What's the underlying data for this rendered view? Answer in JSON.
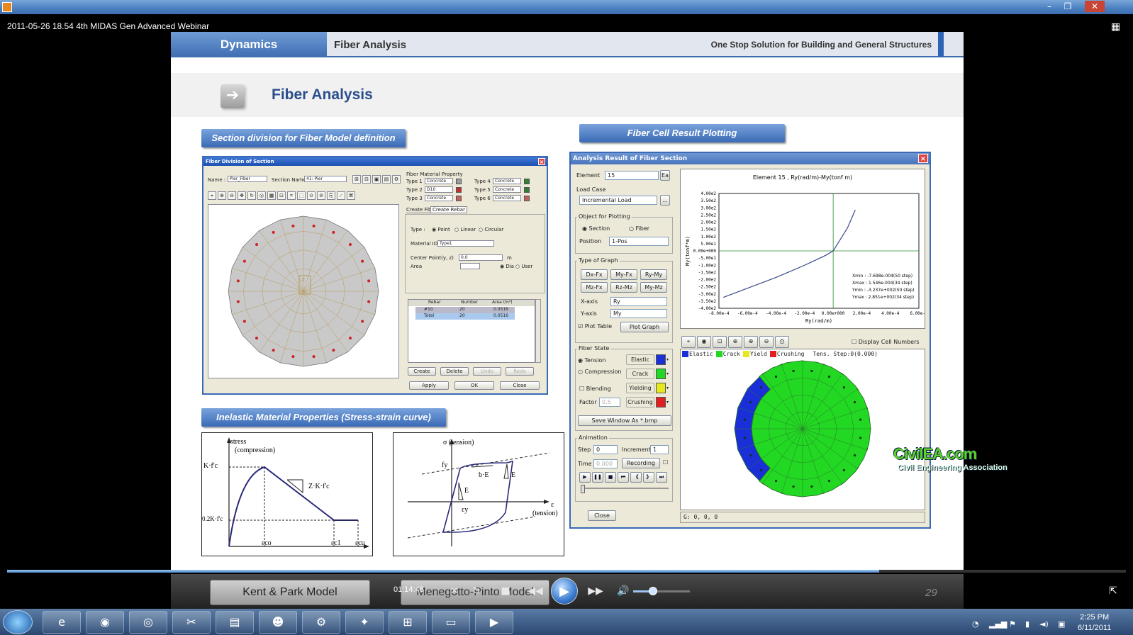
{
  "window": {
    "minimize": "–",
    "restore": "❐",
    "close": "✕"
  },
  "video_title": "2011-05-26 18.54 4th MIDAS Gen Advanced Webinar",
  "slide": {
    "tab_main": "Dynamics",
    "tab_sub": "Fiber Analysis",
    "slogan": "One Stop Solution for Building and General Structures",
    "title": "Fiber Analysis",
    "section_left": "Section division for Fiber Model definition",
    "section_right": "Fiber Cell Result Plotting",
    "section_material": "Inelastic Material Properties (Stress-strain curve)",
    "page_number": "29"
  },
  "fiber_division_dialog": {
    "title": "Fiber Division of Section",
    "name_label": "Name :",
    "name_value": "Pier_Fiber",
    "section_label": "Section Name :",
    "section_value": "41: Pier",
    "material_header": "Fiber Material Property",
    "types": [
      {
        "label": "Type 1",
        "value": "Concrete",
        "color": "#9a9a9a"
      },
      {
        "label": "Type 2",
        "value": "D10",
        "color": "#c03030"
      },
      {
        "label": "Type 3",
        "value": "Concrete",
        "color": "#c06060"
      },
      {
        "label": "Type 4",
        "value": "Concrete",
        "color": "#308030"
      },
      {
        "label": "Type 5",
        "value": "Concrete",
        "color": "#308030"
      },
      {
        "label": "Type 6",
        "value": "Concrete",
        "color": "#c06060"
      }
    ],
    "tabs": [
      "Create Fiber",
      "Create Rebar"
    ],
    "type_label": "Type :",
    "type_options": [
      "Point",
      "Linear",
      "Circular"
    ],
    "material_id_label": "Material ID :",
    "material_id_value": "Type1",
    "center_label": "Center Point(y, z)",
    "center_value": "0,0",
    "center_unit": "m",
    "area_label": "Area",
    "area_opts": [
      "Dia",
      "User"
    ],
    "table_headers": [
      "Rebar",
      "Number",
      "Area (m²)"
    ],
    "table_rows": [
      [
        "#10",
        "20",
        "0.0516"
      ],
      [
        "Total",
        "20",
        "0.0516"
      ]
    ],
    "table_buttons": [
      "Create",
      "Delete",
      "Undo",
      "Redo"
    ],
    "buttons": [
      "Apply",
      "OK",
      "Close"
    ]
  },
  "analysis_dialog": {
    "title": "Analysis Result of Fiber Section",
    "element_label": "Element",
    "element_value": "15",
    "element_btn": "Ea",
    "load_case_label": "Load Case",
    "load_case_value": "Incremental Load",
    "object_label": "Object for Plotting",
    "object_options": [
      "Section",
      "Fiber"
    ],
    "position_label": "Position",
    "position_value": "1-Pos",
    "graph_type_label": "Type of Graph",
    "graph_buttons": [
      "Dx-Fx",
      "My-Fx",
      "Ry-My",
      "Mz-Fx",
      "Rz-Mz",
      "My-Mz"
    ],
    "xaxis_label": "X-axis",
    "xaxis_value": "Ry",
    "yaxis_label": "Y-axis",
    "yaxis_value": "My",
    "plot_table_label": "Plot Table",
    "plot_graph_btn": "Plot Graph",
    "fiber_state_label": "Fiber State",
    "state_options": [
      "Tension",
      "Compression"
    ],
    "blending_label": "Blending",
    "factor_label": "Factor",
    "factor_value": "0.5",
    "states": [
      {
        "label": "Elastic",
        "color": "#1a2fd8"
      },
      {
        "label": "Crack",
        "color": "#22d822"
      },
      {
        "label": "Yielding",
        "color": "#e8e820"
      },
      {
        "label": "Crushing",
        "color": "#e02020"
      }
    ],
    "save_btn": "Save Window As *.bmp",
    "animation_label": "Animation",
    "step_label": "Step",
    "step_value": "0",
    "increment_label": "Increment",
    "increment_value": "1",
    "time_label": "Time",
    "time_value": "0.000",
    "recording_btn": "Recording",
    "anim_buttons": [
      "▶",
      "❚❚",
      "■",
      "⏮",
      "《",
      "》",
      "⏭"
    ],
    "close_btn": "Close",
    "display_cell_label": "Display Cell Numbers",
    "legend": [
      {
        "label": "Elastic",
        "color": "#1a2fd8"
      },
      {
        "label": "Crack",
        "color": "#22d822"
      },
      {
        "label": "Yield",
        "color": "#e8e820"
      },
      {
        "label": "Crushing",
        "color": "#e02020"
      }
    ],
    "legend_extra": "Tens.   Step:0(0.000)",
    "status": "G: 0, 0, 0"
  },
  "chart_data": {
    "type": "line",
    "title": "Element 15 , Ry(rad/m)-My(tonf m)",
    "xlabel": "Ry(rad/m)",
    "ylabel": "My(tonf*m)",
    "xlim": [
      -0.0008,
      0.0006
    ],
    "ylim": [
      -400.0,
      400.0
    ],
    "x_ticks": [
      "-8.00e-4",
      "-6.00e-4",
      "-4.00e-4",
      "-2.00e-4",
      "0.00e+000",
      "2.00e-4",
      "4.00e-4",
      "6.00e-4"
    ],
    "y_ticks": [
      "4.00e2",
      "3.50e2",
      "3.00e2",
      "2.50e2",
      "2.00e2",
      "1.50e2",
      "1.00e2",
      "5.00e1",
      "0.00e+000",
      "-5.00e1",
      "-1.00e2",
      "-1.50e2",
      "-2.00e2",
      "-2.50e2",
      "-3.00e2",
      "-3.50e2",
      "-4.00e2"
    ],
    "series": [
      {
        "values": [
          [
            -0.000769,
            -323.7
          ],
          [
            -0.0006,
            -260.0
          ],
          [
            -0.0004,
            -185.0
          ],
          [
            -0.0002,
            -100.0
          ],
          [
            -5e-05,
            -30.0
          ],
          [
            0.0,
            0.0
          ],
          [
            5e-05,
            80.0
          ],
          [
            0.0001,
            160.0
          ],
          [
            0.0001546,
            285.1
          ]
        ]
      }
    ],
    "annotations": [
      "Xmin : -7.698e-004(50 step)",
      "Xmax : 1.546e-004(34 step)",
      "Ymin : -3.237e+002(50 step)",
      "Ymax : 2.851e+002(34 step)"
    ]
  },
  "stress_strain_left": {
    "stress_label": "stress",
    "compression_label": "(compression)",
    "y_marks": [
      "K·f'c",
      "0.2K·f'c"
    ],
    "slope_label": "Z·K·f'c",
    "x_marks": [
      "εco",
      "εc1",
      "εcu"
    ]
  },
  "stress_strain_right": {
    "y_label": "σ (tension)",
    "x_label": "ε",
    "x_label2": "(tension)",
    "fy": "fy",
    "ey": "εy",
    "bE": "b·E",
    "E1": "E",
    "E2": "E"
  },
  "player": {
    "model_left": "Kent & Park Model",
    "model_right": "Menegotto-Pinto Model",
    "timecode": "01:14:48",
    "controls": [
      "✕",
      "↻",
      "■",
      "◀◀",
      "▶",
      "▶▶",
      "🔊"
    ]
  },
  "watermark": {
    "brand": "CivilEA.com",
    "tagline": "Civil Engineering Association"
  },
  "taskbar": {
    "apps": [
      "ie-icon",
      "firefox-icon",
      "chrome-icon",
      "tools-icon",
      "app-icon",
      "smile-icon",
      "gear-icon",
      "folder-icon",
      "grid-icon",
      "explorer-icon",
      "media-icon"
    ],
    "time": "2:25 PM",
    "date": "6/11/2011"
  }
}
